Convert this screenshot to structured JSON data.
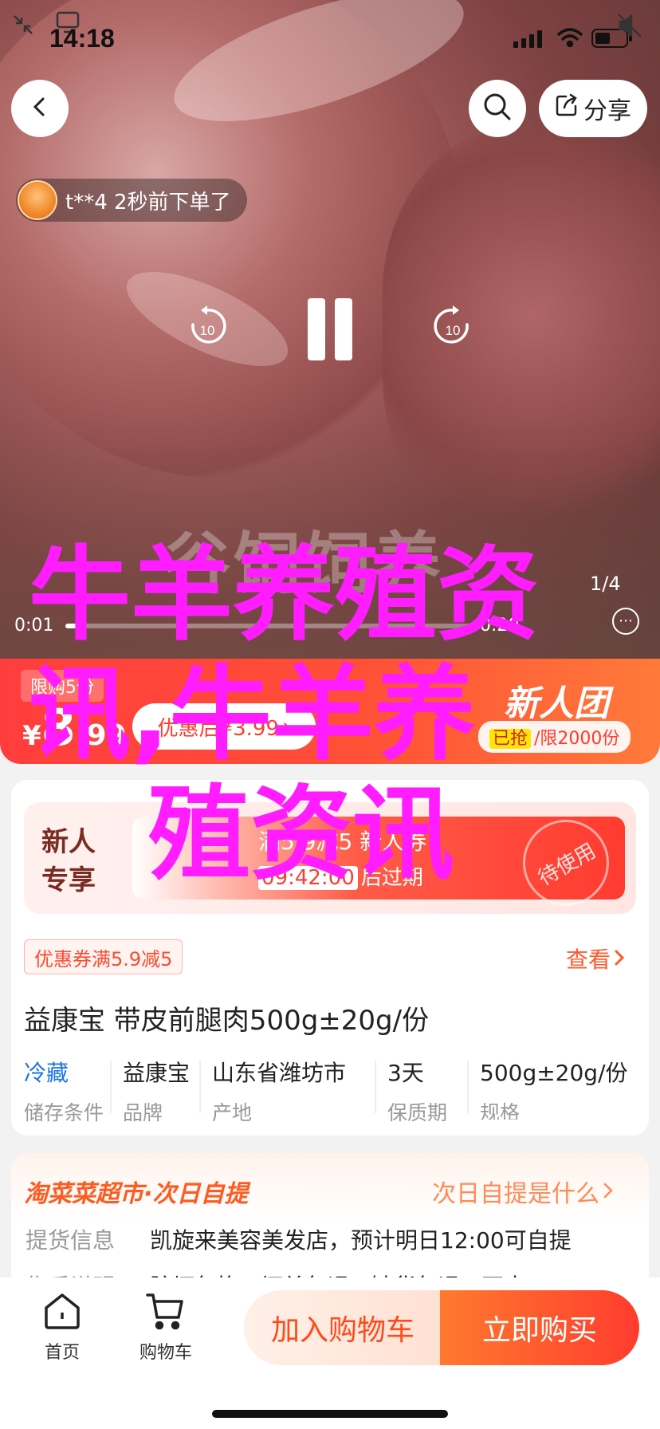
{
  "status_bar": {
    "time": "14:18"
  },
  "nav": {
    "share_label": "分享"
  },
  "buyer_feed": {
    "text": "t**4 2秒前下单了"
  },
  "video": {
    "watermark": "谷饲饲养",
    "current_time": "0:01",
    "duration": "0:20",
    "page_indicator": "1/4",
    "progress_fraction": 0.05,
    "skip_back_label": "10",
    "skip_forward_label": "10"
  },
  "price_banner": {
    "tag": "限购5份",
    "currency": "¥",
    "price_int": "8",
    "price_dec": ".99",
    "after_coupon": "优惠后¥3.99",
    "brand": "新人团",
    "limit_prefix": "已抢",
    "limit_text": "/限2000份"
  },
  "coupon": {
    "badge_line1": "新人",
    "badge_line2": "专享",
    "title": "满5.9减5 新人券",
    "countdown": "09:42:00",
    "countdown_suffix": "后过期",
    "stamp": "待使用"
  },
  "promo": {
    "chip": "优惠券满5.9减5",
    "view_label": "查看"
  },
  "product": {
    "title": "益康宝 带皮前腿肉500g±20g/份",
    "attributes": [
      {
        "value": "冷藏",
        "key": "储存条件"
      },
      {
        "value": "益康宝",
        "key": "品牌"
      },
      {
        "value": "山东省潍坊市",
        "key": "产地"
      },
      {
        "value": "3天",
        "key": "保质期"
      },
      {
        "value": "500g±20g/份",
        "key": "规格"
      }
    ]
  },
  "pickup": {
    "brand": "淘菜菜超市·次日自提",
    "what_label": "次日自提是什么",
    "rows": [
      {
        "key": "提货信息",
        "value": "凯旋来美容美发店，预计明日12:00可自提"
      },
      {
        "key": "售后说明",
        "value": "脏坏包换 · 坏单包退 · 缺货包退 · 不支"
      }
    ]
  },
  "bottom_bar": {
    "home_label": "首页",
    "cart_label": "购物车",
    "add_cart_label": "加入购物车",
    "buy_now_label": "立即购买"
  },
  "overlay_text": {
    "line1": "牛羊养殖资",
    "line2": "讯,牛羊养",
    "line3": "殖资讯"
  },
  "colors": {
    "accent": "#ff3b30",
    "overlay": "#ff1dff",
    "link_blue": "#1a73e8"
  }
}
